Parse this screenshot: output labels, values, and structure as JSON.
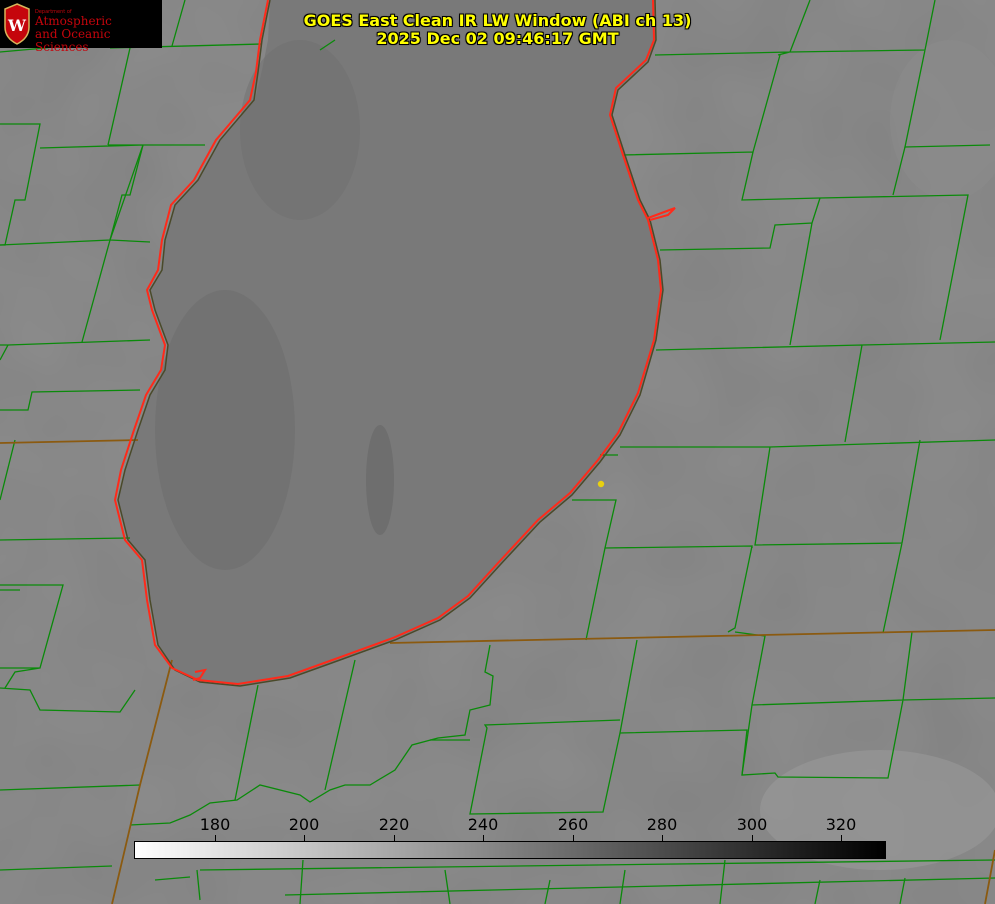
{
  "title": {
    "line1": "GOES East Clean IR LW Window (ABI ch 13)",
    "line2": "2025 Dec 02 09:46:17 GMT"
  },
  "logo": {
    "department": "Department of",
    "name_line1": "Atmospheric",
    "name_line2": "and Oceanic Sciences",
    "crest_letter": "W",
    "crest_color": "#c5050c"
  },
  "colorbar": {
    "ticks": [
      "180",
      "200",
      "220",
      "240",
      "260",
      "280",
      "300",
      "320"
    ],
    "gradient_from": "#ffffff",
    "gradient_to": "#000000"
  },
  "colors": {
    "coastline": "#ff2a1a",
    "county_lines": "#0a8a0a",
    "state_lines": "#8b5a10",
    "background": "#808080",
    "title_text": "#ffff00",
    "marker": "#e8d010"
  }
}
